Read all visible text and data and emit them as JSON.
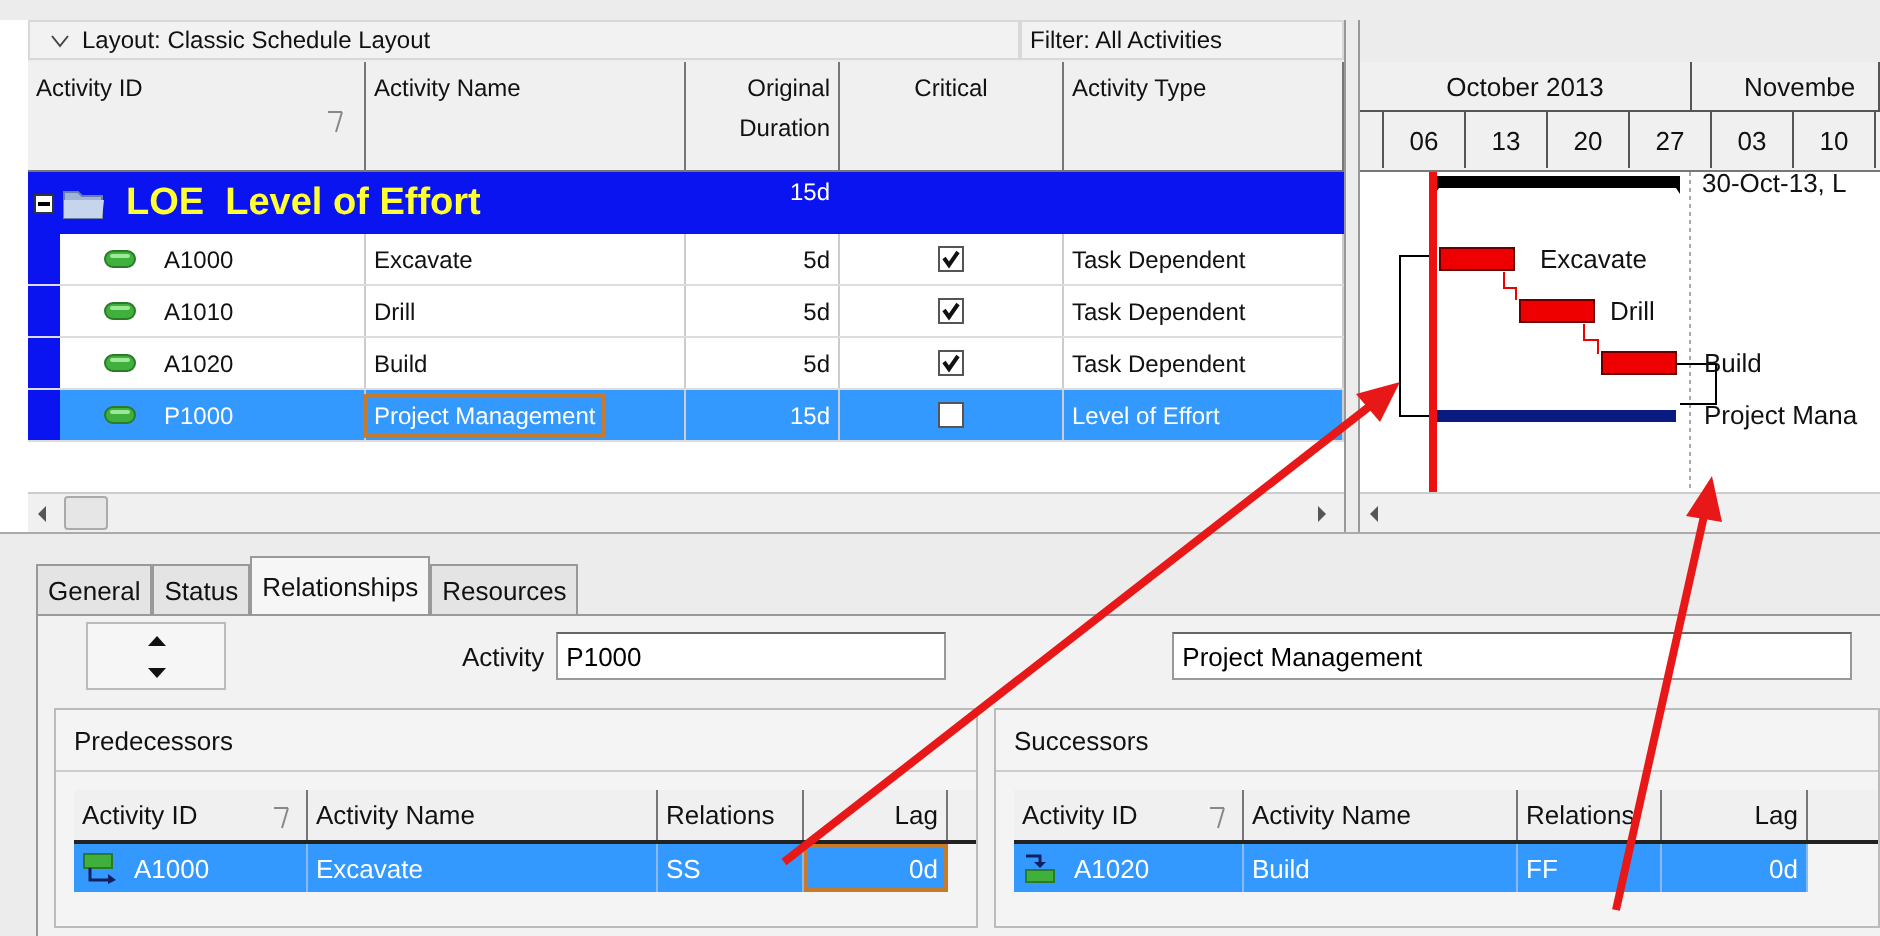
{
  "layout_bar": {
    "layout": "Layout: Classic Schedule Layout",
    "filter": "Filter: All Activities"
  },
  "columns": [
    {
      "label": "Activity ID",
      "sorted": true
    },
    {
      "label": "Activity Name",
      "sorted": false
    },
    {
      "label": "Original Duration",
      "sorted": false
    },
    {
      "label": "Critical",
      "sorted": false
    },
    {
      "label": "Activity Type",
      "sorted": false
    }
  ],
  "group": {
    "id": "LOE",
    "name": "Level of Effort",
    "duration": "15d",
    "expanded": true
  },
  "activities": [
    {
      "id": "A1000",
      "name": "Excavate",
      "duration": "5d",
      "critical": true,
      "type": "Task Dependent",
      "selected": false
    },
    {
      "id": "A1010",
      "name": "Drill",
      "duration": "5d",
      "critical": true,
      "type": "Task Dependent",
      "selected": false
    },
    {
      "id": "A1020",
      "name": "Build",
      "duration": "5d",
      "critical": true,
      "type": "Task Dependent",
      "selected": false
    },
    {
      "id": "P1000",
      "name": "Project Management",
      "duration": "15d",
      "critical": false,
      "type": "Level of Effort",
      "selected": true
    }
  ],
  "gantt": {
    "months": [
      "October 2013",
      "Novembe"
    ],
    "weeks": [
      "06",
      "13",
      "20",
      "27",
      "03",
      "10"
    ],
    "summary_label": "30-Oct-13, L",
    "bar_labels": [
      "Excavate",
      "Drill",
      "Build",
      "Project Mana"
    ]
  },
  "details": {
    "tabs": [
      {
        "label": "General",
        "selected": false
      },
      {
        "label": "Status",
        "selected": false
      },
      {
        "label": "Relationships",
        "selected": true
      },
      {
        "label": "Resources",
        "selected": false
      }
    ],
    "activity_label": "Activity",
    "activity_id": "P1000",
    "activity_name": "Project Management",
    "predecessors": {
      "title": "Predecessors",
      "columns": [
        "Activity ID",
        "Activity Name",
        "Relations",
        "Lag"
      ],
      "rows": [
        {
          "id": "A1000",
          "name": "Excavate",
          "relation": "SS",
          "lag": "0d",
          "selected": true
        }
      ]
    },
    "successors": {
      "title": "Successors",
      "columns": [
        "Activity ID",
        "Activity Name",
        "Relations",
        "Lag"
      ],
      "rows": [
        {
          "id": "A1020",
          "name": "Build",
          "relation": "FF",
          "lag": "0d",
          "selected": true
        }
      ]
    }
  }
}
